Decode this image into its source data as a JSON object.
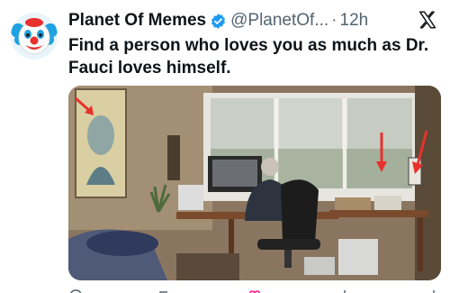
{
  "tweet": {
    "display_name": "Planet Of Memes",
    "handle": "@PlanetOf...",
    "separator": "·",
    "time": "12h",
    "verified_icon": "verified-badge-icon",
    "avatar_icon": "clown-face-emoji",
    "text": "Find a person who loves you as much as Dr. Fauci loves himself."
  },
  "brand": {
    "logo_icon": "x-logo-icon",
    "accent": "#1d9bf0"
  },
  "media": {
    "description_icons": [
      "portrait-painting",
      "office-desk",
      "person-in-chair",
      "red-arrow-icon"
    ],
    "arrow_color": "#e8312d"
  },
  "actions": [
    "reply-icon",
    "repost-icon",
    "like-icon",
    "views-icon",
    "share-icon"
  ]
}
